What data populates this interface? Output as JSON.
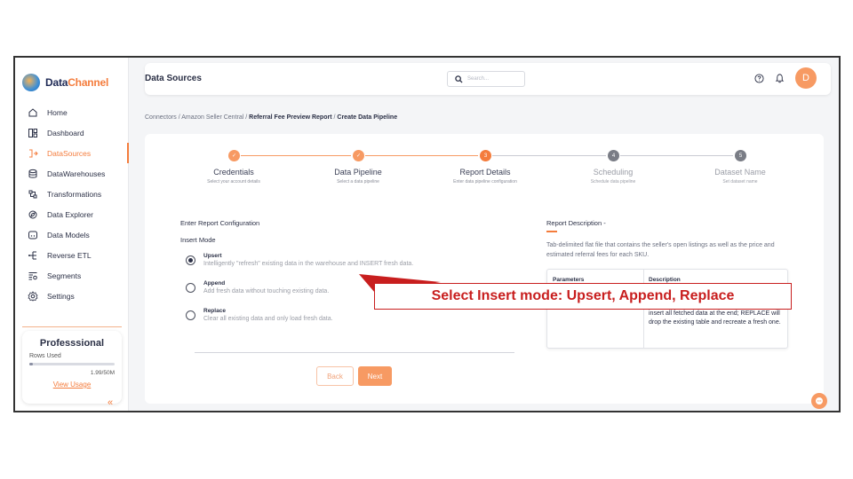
{
  "app": {
    "logo_prefix": "Data",
    "logo_suffix": "Channel"
  },
  "sidebar": {
    "items": [
      {
        "label": "Home",
        "icon": "home-icon"
      },
      {
        "label": "Dashboard",
        "icon": "dashboard-icon"
      },
      {
        "label": "DataSources",
        "icon": "datasources-icon",
        "active": true
      },
      {
        "label": "DataWarehouses",
        "icon": "database-icon"
      },
      {
        "label": "Transformations",
        "icon": "transformations-icon"
      },
      {
        "label": "Data Explorer",
        "icon": "explorer-icon"
      },
      {
        "label": "Data Models",
        "icon": "models-icon"
      },
      {
        "label": "Reverse ETL",
        "icon": "reverse-etl-icon"
      },
      {
        "label": "Segments",
        "icon": "segments-icon"
      },
      {
        "label": "Settings",
        "icon": "gear-icon"
      }
    ],
    "plan": {
      "name": "Professsional",
      "rows_label": "Rows Used",
      "usage_text": "1.99/50M",
      "usage_fraction": 0.04,
      "view_usage": "View Usage"
    },
    "collapse_glyph": "«"
  },
  "header": {
    "title": "Data Sources",
    "search_placeholder": "Search...",
    "avatar_initial": "D"
  },
  "breadcrumb": {
    "part1": "Connectors",
    "sep": "/",
    "part2": "Amazon Seller Central",
    "part3": "Referral Fee Preview Report",
    "part4": "Create Data Pipeline"
  },
  "steps": [
    {
      "number": "1",
      "title": "Credentials",
      "subtitle": "Select your account details",
      "state": "done"
    },
    {
      "number": "2",
      "title": "Data Pipeline",
      "subtitle": "Select a data pipeline",
      "state": "done"
    },
    {
      "number": "3",
      "title": "Report Details",
      "subtitle": "Enter data pipeline configuration",
      "state": "current"
    },
    {
      "number": "4",
      "title": "Scheduling",
      "subtitle": "Schedule data pipeline",
      "state": "todo"
    },
    {
      "number": "5",
      "title": "Dataset Name",
      "subtitle": "Set dataset name",
      "state": "todo"
    }
  ],
  "form": {
    "heading": "Enter Report Configuration",
    "insert_mode_label": "Insert Mode",
    "options": [
      {
        "title": "Upsert",
        "description": "Intelligently \"refresh\" existing data in the warehouse and INSERT fresh data.",
        "checked": true
      },
      {
        "title": "Append",
        "description": "Add fresh data without touching existing data.",
        "checked": false
      },
      {
        "title": "Replace",
        "description": "Clear all existing data and only load fresh data.",
        "checked": false
      }
    ],
    "back_label": "Back",
    "next_label": "Next"
  },
  "report_description": {
    "title": "Report Description -",
    "text": "Tab-delimited flat file that contains the seller's open listings as well as the price and estimated referral fees for each SKU.",
    "table_head_params": "Parameters",
    "table_head_desc": "Description",
    "table_desc_visible": "insert all fetched data at the end; REPLACE will drop the existing table and recreate a fresh one."
  },
  "annotation": {
    "text": "Select Insert mode: Upsert, Append, Replace"
  },
  "colors": {
    "accent": "#f47c3c",
    "annotation_red": "#c81e1e"
  }
}
